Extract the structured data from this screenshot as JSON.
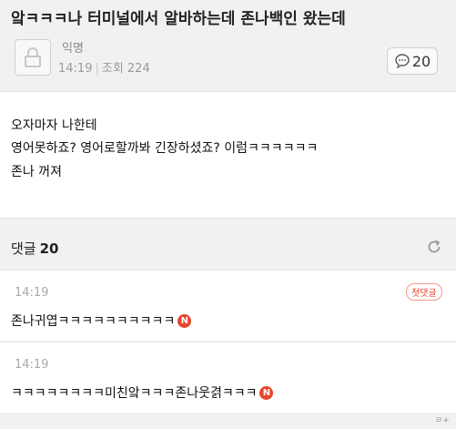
{
  "post": {
    "title": "앜ㅋㅋㅋ나 터미널에서 알바하는데 존나백인 왔는데",
    "author": "익명",
    "time": "14:19",
    "views_label": "조회 224",
    "comment_count": "20"
  },
  "content": {
    "lines": [
      "오자마자 나한테",
      "영어못하죠? 영어로할까봐 긴장하셨죠? 이럼ㅋㅋㅋㅋㅋㅋ",
      "존나 꺼져"
    ]
  },
  "comments_section": {
    "label": "댓글",
    "count": "20"
  },
  "comments": [
    {
      "time": "14:19",
      "text": "존나귀엽ㅋㅋㅋㅋㅋㅋㅋㅋㅋㅋ",
      "new_badge": "N",
      "first_badge": "첫댓글"
    },
    {
      "time": "14:19",
      "text": "ㅋㅋㅋㅋㅋㅋㅋㅋ미친앜ㅋㅋㅋ존나웃겱ㅋㅋㅋ",
      "new_badge": "N"
    }
  ],
  "watermark": "ㄹ+",
  "icons": {
    "avatar": "anonymous-lock-icon",
    "comment_badge": "speech-bubble-icon",
    "refresh": "refresh-icon",
    "new_badge": "new-badge-icon"
  },
  "colors": {
    "accent": "#e8452c",
    "background": "#f1f1f1",
    "card": "#ffffff"
  }
}
